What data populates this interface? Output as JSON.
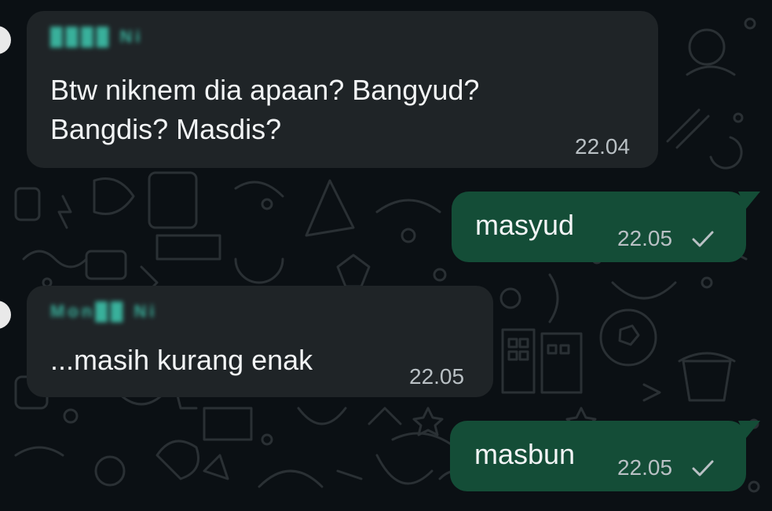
{
  "chat": {
    "messages": [
      {
        "direction": "incoming",
        "sender": "████ Ni",
        "text": "Btw niknem dia apaan? Bangyud?\nBangdis? Masdis?",
        "time": "22.04"
      },
      {
        "direction": "outgoing",
        "text": "masyud",
        "time": "22.05",
        "status": "sent-single-check"
      },
      {
        "direction": "incoming",
        "sender": "Mon██ Ni",
        "text": "...masih kurang enak",
        "time": "22.05"
      },
      {
        "direction": "outgoing",
        "text": "masbun",
        "time": "22.05",
        "status": "sent-single-check"
      }
    ]
  },
  "colors": {
    "background": "#0b1014",
    "incoming_bubble": "#1f2427",
    "outgoing_bubble": "#144d37",
    "sender_name": "#3ec9b0",
    "timestamp": "#b9c0c4",
    "doodle": "#2a3034"
  }
}
